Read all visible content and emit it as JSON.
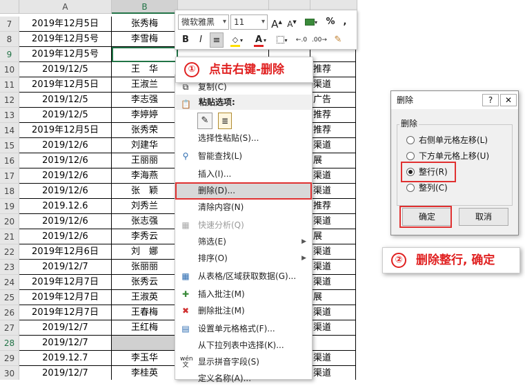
{
  "sheet": {
    "columns": [
      "A",
      "B"
    ],
    "rows": [
      {
        "num": "7",
        "a": "2019年12月5日",
        "b": "张秀梅",
        "e": ""
      },
      {
        "num": "8",
        "a": "2019年12月5号",
        "b": "李雪梅",
        "e": ""
      },
      {
        "num": "9",
        "a": "2019年12月5号",
        "b": "",
        "e": ""
      },
      {
        "num": "10",
        "a": "2019/12/5",
        "b": "王　华",
        "e": "推荐"
      },
      {
        "num": "11",
        "a": "2019年12月5日",
        "b": "王淑兰",
        "e": "渠道"
      },
      {
        "num": "12",
        "a": "2019/12/5",
        "b": "李志强",
        "e": "广告"
      },
      {
        "num": "13",
        "a": "2019/12/5",
        "b": "李婷婷",
        "e": "推荐"
      },
      {
        "num": "14",
        "a": "2019年12月5日",
        "b": "张秀荣",
        "e": "推荐"
      },
      {
        "num": "15",
        "a": "2019/12/6",
        "b": "刘建华",
        "e": "渠道"
      },
      {
        "num": "16",
        "a": "2019/12/6",
        "b": "王丽丽",
        "e": "展"
      },
      {
        "num": "17",
        "a": "2019/12/6",
        "b": "李海燕",
        "e": "渠道"
      },
      {
        "num": "18",
        "a": "2019/12/6",
        "b": "张　颖",
        "e": "渠道"
      },
      {
        "num": "19",
        "a": "2019.12.6",
        "b": "刘秀兰",
        "e": "推荐"
      },
      {
        "num": "20",
        "a": "2019/12/6",
        "b": "张志强",
        "e": "渠道"
      },
      {
        "num": "21",
        "a": "2019/12/6",
        "b": "李秀云",
        "e": "展"
      },
      {
        "num": "22",
        "a": "2019年12月6日",
        "b": "刘　娜",
        "e": "渠道"
      },
      {
        "num": "23",
        "a": "2019/12/7",
        "b": "张丽丽",
        "e": "渠道"
      },
      {
        "num": "24",
        "a": "2019年12月7日",
        "b": "张秀云",
        "e": "渠道"
      },
      {
        "num": "25",
        "a": "2019年12月7日",
        "b": "王淑英",
        "e": "展"
      },
      {
        "num": "26",
        "a": "2019年12月7日",
        "b": "王春梅",
        "e": "渠道"
      },
      {
        "num": "27",
        "a": "2019/12/7",
        "b": "王红梅",
        "e": "渠道"
      },
      {
        "num": "28",
        "a": "2019/12/7",
        "b": "",
        "e": ""
      },
      {
        "num": "29",
        "a": "2019.12.7",
        "b": "李玉华",
        "e": "渠道"
      },
      {
        "num": "30",
        "a": "2019/12/7",
        "b": "李桂英",
        "e": "渠道"
      }
    ]
  },
  "mini_toolbar": {
    "font": "微软雅黑",
    "size": "11",
    "grow": "A",
    "shrink": "A",
    "percent": "%",
    "comma": ",",
    "bold": "B",
    "italic": "I",
    "font_color": "A"
  },
  "callout1": {
    "num": "①",
    "text": "点击右键-删除"
  },
  "callout2": {
    "num": "②",
    "text": "删除整行, 确定"
  },
  "menu": {
    "copy": "复制(C)",
    "paste_header": "粘贴选项:",
    "paste_special": "选择性粘贴(S)...",
    "smart_lookup": "智能查找(L)",
    "insert": "插入(I)...",
    "delete": "删除(D)...",
    "clear": "清除内容(N)",
    "quick_analysis": "快速分析(Q)",
    "filter": "筛选(E)",
    "sort": "排序(O)",
    "get_data": "从表格/区域获取数据(G)...",
    "insert_comment": "插入批注(M)",
    "delete_comment": "删除批注(M)",
    "format_cells": "设置单元格格式(F)...",
    "pick_list": "从下拉列表中选择(K)...",
    "phonetic": "显示拼音字段(S)",
    "define_name": "定义名称(A)..."
  },
  "dialog": {
    "title": "删除",
    "help": "?",
    "close": "✕",
    "group": "删除",
    "options": [
      {
        "label": "右侧单元格左移(L)",
        "checked": false
      },
      {
        "label": "下方单元格上移(U)",
        "checked": false
      },
      {
        "label": "整行(R)",
        "checked": true
      },
      {
        "label": "整列(C)",
        "checked": false
      }
    ],
    "ok": "确定",
    "cancel": "取消"
  },
  "colors": {
    "highlight": "#e03030",
    "callout_text": "#e02020",
    "excel_green": "#217346"
  }
}
